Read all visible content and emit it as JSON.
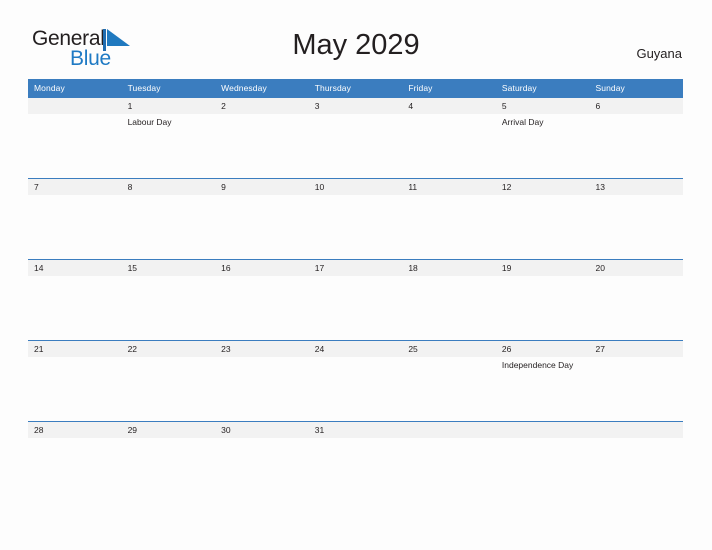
{
  "brand": {
    "name_dark": "General",
    "name_blue": "Blue",
    "flag_icon": "triangle-flag-icon",
    "accent_color": "#1f7ac4"
  },
  "header": {
    "title": "May 2029",
    "region": "Guyana"
  },
  "colors": {
    "header_blue": "#3b7dbf",
    "band_gray": "#f2f2f2",
    "text_dark": "#231f20",
    "page_background": "#fdfdfd"
  },
  "calendar": {
    "weekday_headers": [
      "Monday",
      "Tuesday",
      "Wednesday",
      "Thursday",
      "Friday",
      "Saturday",
      "Sunday"
    ],
    "weeks": [
      {
        "days": [
          {
            "date": "",
            "event": ""
          },
          {
            "date": "1",
            "event": "Labour Day"
          },
          {
            "date": "2",
            "event": ""
          },
          {
            "date": "3",
            "event": ""
          },
          {
            "date": "4",
            "event": ""
          },
          {
            "date": "5",
            "event": "Arrival Day"
          },
          {
            "date": "6",
            "event": ""
          }
        ]
      },
      {
        "days": [
          {
            "date": "7",
            "event": ""
          },
          {
            "date": "8",
            "event": ""
          },
          {
            "date": "9",
            "event": ""
          },
          {
            "date": "10",
            "event": ""
          },
          {
            "date": "11",
            "event": ""
          },
          {
            "date": "12",
            "event": ""
          },
          {
            "date": "13",
            "event": ""
          }
        ]
      },
      {
        "days": [
          {
            "date": "14",
            "event": ""
          },
          {
            "date": "15",
            "event": ""
          },
          {
            "date": "16",
            "event": ""
          },
          {
            "date": "17",
            "event": ""
          },
          {
            "date": "18",
            "event": ""
          },
          {
            "date": "19",
            "event": ""
          },
          {
            "date": "20",
            "event": ""
          }
        ]
      },
      {
        "days": [
          {
            "date": "21",
            "event": ""
          },
          {
            "date": "22",
            "event": ""
          },
          {
            "date": "23",
            "event": ""
          },
          {
            "date": "24",
            "event": ""
          },
          {
            "date": "25",
            "event": ""
          },
          {
            "date": "26",
            "event": "Independence Day"
          },
          {
            "date": "27",
            "event": ""
          }
        ]
      },
      {
        "days": [
          {
            "date": "28",
            "event": ""
          },
          {
            "date": "29",
            "event": ""
          },
          {
            "date": "30",
            "event": ""
          },
          {
            "date": "31",
            "event": ""
          },
          {
            "date": "",
            "event": ""
          },
          {
            "date": "",
            "event": ""
          },
          {
            "date": "",
            "event": ""
          }
        ]
      }
    ]
  }
}
